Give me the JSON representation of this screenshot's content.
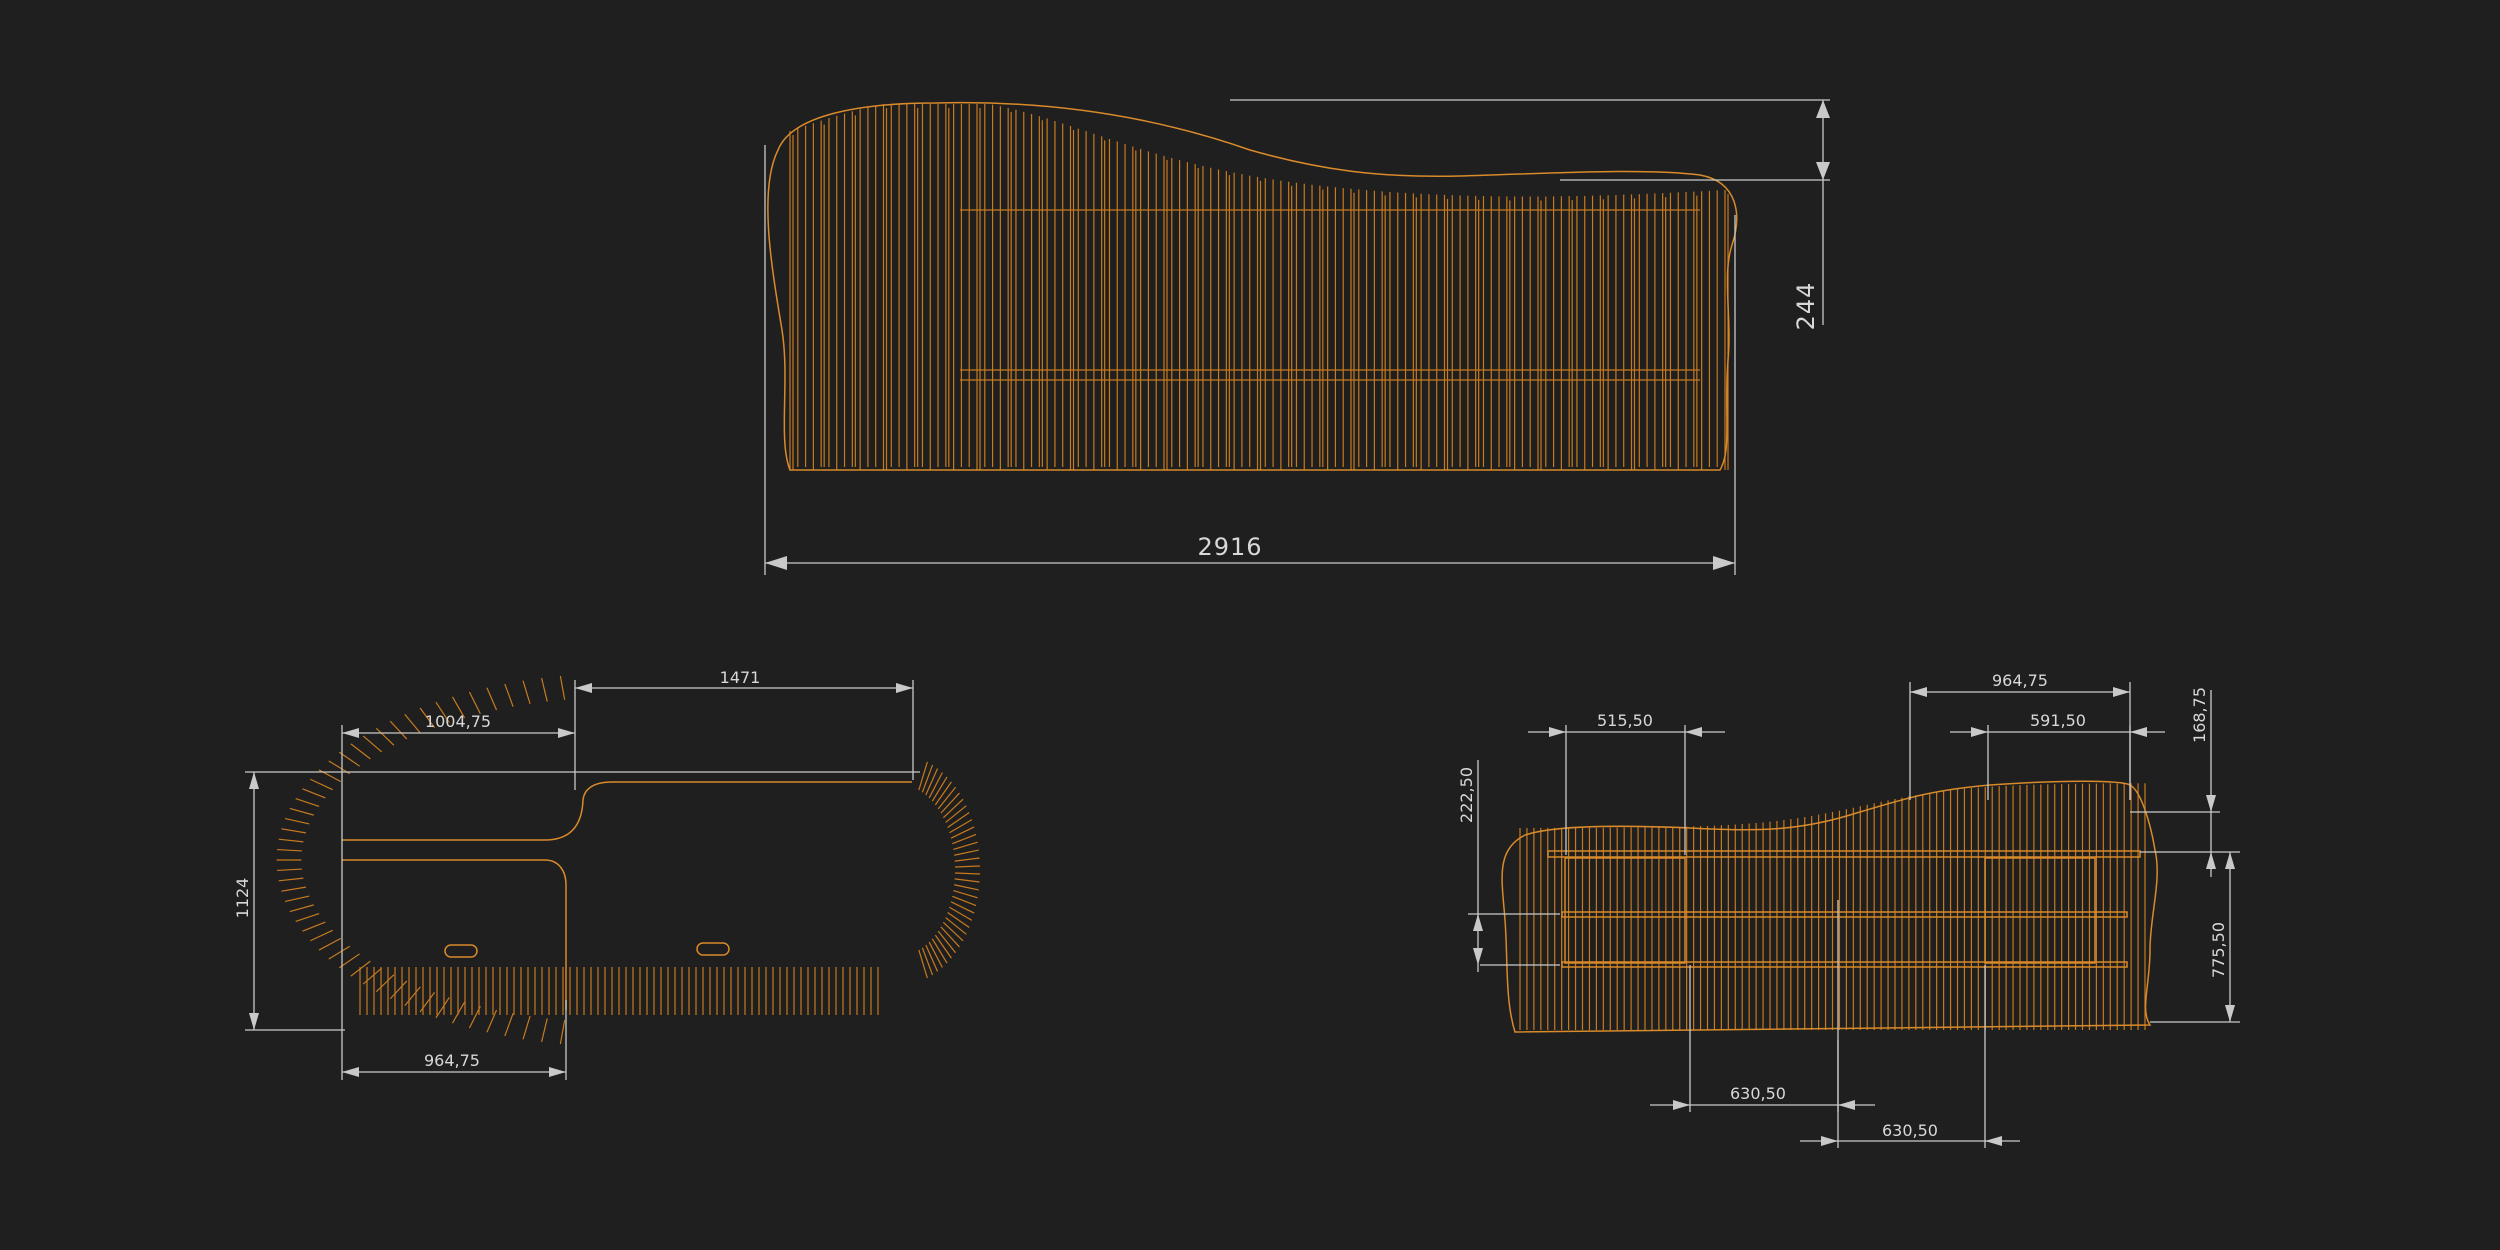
{
  "colors": {
    "background": "#1f1f1f",
    "model_lines": "#c77a1f",
    "dimension_lines": "#c9c9c9",
    "dimension_text": "#d8d8d8"
  },
  "elevation": {
    "overall_length": "2916",
    "height": "244"
  },
  "plan": {
    "top_width": "1471",
    "left_offset": "1004,75",
    "depth": "1124",
    "bottom_width": "964,75"
  },
  "section": {
    "top_right_width": "964,75",
    "top_left_width": "515,50",
    "top_mid_width": "591,50",
    "right_top_height": "168,75",
    "left_height": "222,50",
    "right_height": "775,50",
    "bottom_left_width": "630,50",
    "bottom_right_width": "630,50"
  }
}
